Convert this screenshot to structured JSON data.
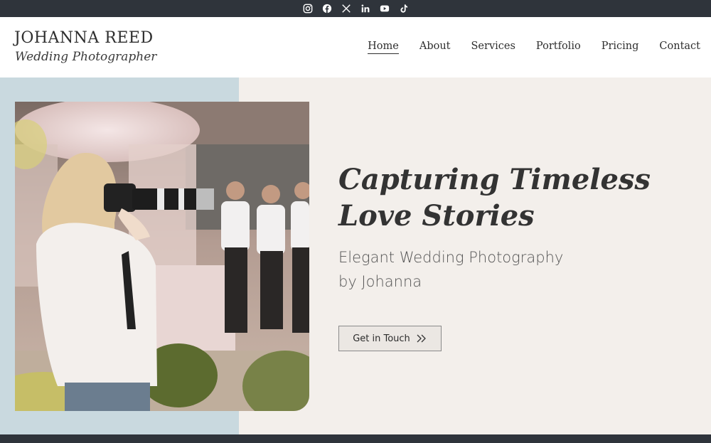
{
  "social": {
    "icons": [
      "instagram-icon",
      "facebook-icon",
      "x-icon",
      "linkedin-icon",
      "youtube-icon",
      "tiktok-icon"
    ],
    "bar_color": "#2f343b"
  },
  "brand": {
    "name": "JOHANNA REED",
    "tagline": "Wedding Photographer"
  },
  "nav": {
    "items": [
      {
        "label": "Home",
        "active": true
      },
      {
        "label": "About"
      },
      {
        "label": "Services"
      },
      {
        "label": "Portfolio"
      },
      {
        "label": "Pricing"
      },
      {
        "label": "Contact"
      }
    ]
  },
  "hero": {
    "title_line1": "Capturing Timeless",
    "title_line2": "Love Stories",
    "subtitle_line1": "Elegant Wedding Photography",
    "subtitle_line2": "by Johanna",
    "cta_label": "Get in Touch",
    "accent_color": "#c9d9df",
    "background_color": "#f3efeb"
  }
}
